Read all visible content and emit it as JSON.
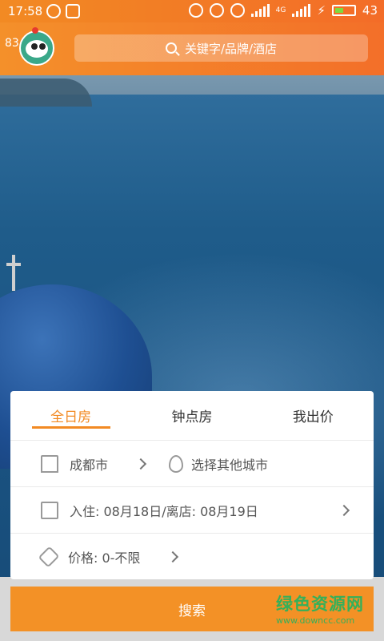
{
  "status_bar": {
    "time": "17:58",
    "network_label": "4G",
    "battery_level": "43"
  },
  "header": {
    "badge_count": "83",
    "search_placeholder": "关键字/品牌/酒店"
  },
  "tabs": [
    {
      "label": "全日房",
      "active": true
    },
    {
      "label": "钟点房",
      "active": false
    },
    {
      "label": "我出价",
      "active": false
    }
  ],
  "city_row": {
    "current_city": "成都市",
    "other_city": "选择其他城市"
  },
  "date_row": {
    "text": "入住: 08月18日/离店: 08月19日"
  },
  "price_row": {
    "text": "价格: 0-不限"
  },
  "search_button": {
    "label": "搜索"
  },
  "watermark": {
    "title": "绿色资源网",
    "url": "www.downcc.com"
  },
  "colors": {
    "accent": "#f28a23",
    "watermark": "#34b05a"
  }
}
